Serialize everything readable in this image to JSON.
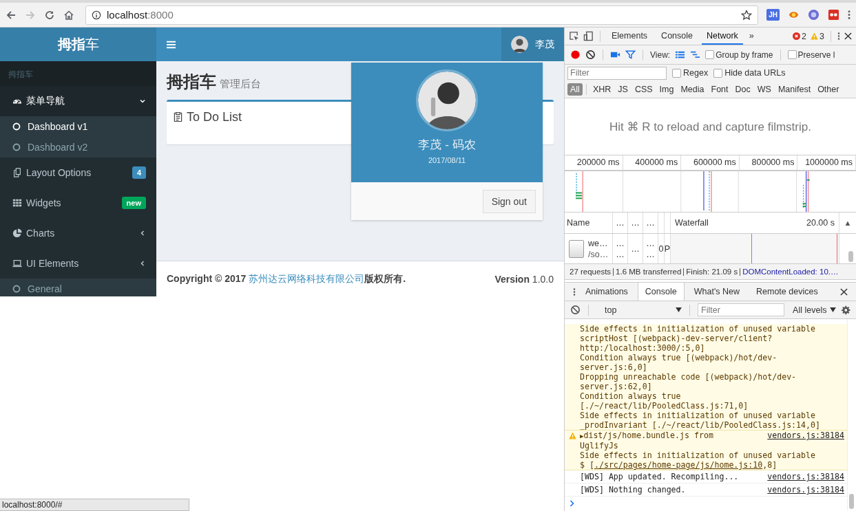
{
  "browser": {
    "url": {
      "host": "localhost",
      "port": ":8000"
    },
    "extension_label": "JH",
    "status_url": "localhost:8000/#"
  },
  "app": {
    "logo": "**拇指**车",
    "user": {
      "name": "李茂"
    },
    "sidebar": {
      "section": "拇指车",
      "items": [
        {
          "label": "菜单导航",
          "kind": "gauge",
          "selected": true,
          "expanded": true,
          "children": [
            {
              "label": "Dashboard v1",
              "selected": true
            },
            {
              "label": "Dashboard v2",
              "selected": false
            }
          ]
        },
        {
          "label": "Layout Options",
          "kind": "copy",
          "selected": false,
          "badge": {
            "text": "4",
            "color": "#3c8dbc"
          }
        },
        {
          "label": "Widgets",
          "kind": "grid",
          "selected": false,
          "badge": {
            "text": "new",
            "color": "#00a65a"
          }
        },
        {
          "label": "Charts",
          "kind": "pie",
          "selected": false,
          "expanded": false
        },
        {
          "label": "UI Elements",
          "kind": "laptop",
          "selected": false,
          "expanded": false,
          "children": [
            {
              "label": "General",
              "selected": false
            }
          ]
        }
      ]
    },
    "page_title": "拇指车",
    "page_subtitle": "管理后台",
    "box": {
      "title": "To Do List"
    },
    "user_menu": {
      "name": "李茂 - 码农",
      "date": "2017/08/11",
      "button": "Sign out"
    },
    "footer": {
      "copyright_before": "Copyright © 2017 ",
      "company": "苏州达云网络科技有限公司",
      "copyright_after": "版权所有.",
      "version": "**Version** 1.0.0"
    }
  },
  "devtools": {
    "tabs": [
      {
        "label": "Elements",
        "selected": false
      },
      {
        "label": "Console",
        "selected": false
      },
      {
        "label": "Network",
        "selected": true
      }
    ],
    "more_tabs": "»",
    "errors": "2",
    "warnings": "3",
    "network": {
      "view_label": "View:",
      "options": [
        {
          "label": "Group by frame",
          "checked": false
        },
        {
          "label": "Preserve l",
          "checked": false
        }
      ],
      "filter_placeholder": "Filter",
      "filter_options": [
        {
          "label": "Regex",
          "checked": false
        },
        {
          "label": "Hide data URLs",
          "checked": false
        }
      ],
      "types": [
        {
          "label": "All",
          "selected": true
        },
        {
          "label": "XHR",
          "selected": false
        },
        {
          "label": "JS",
          "selected": false
        },
        {
          "label": "CSS",
          "selected": false
        },
        {
          "label": "Img",
          "selected": false
        },
        {
          "label": "Media",
          "selected": false
        },
        {
          "label": "Font",
          "selected": false
        },
        {
          "label": "Doc",
          "selected": false
        },
        {
          "label": "WS",
          "selected": false
        },
        {
          "label": "Manifest",
          "selected": false
        },
        {
          "label": "Other",
          "selected": false
        }
      ],
      "filmstrip_hint": "Hit ⌘ R to reload and capture filmstrip.",
      "ticks": [
        "200000 ms",
        "400000 ms",
        "600000 ms",
        "800000 ms",
        "1000000 ms"
      ],
      "columns": [
        "Name",
        "…",
        "…",
        "…"
      ],
      "waterfall_label": "Waterfall",
      "time_scale": "20.00 s",
      "sort_indicator": "▲",
      "rows": [
        {
          "cells": [
            [
              "we…",
              "/so…"
            ],
            [
              "…",
              "…"
            ],
            [
              "…"
            ],
            [
              "…",
              "…"
            ],
            [
              "0"
            ],
            [
              "P"
            ]
          ]
        }
      ],
      "summary": [
        "27 requests",
        "1.6 MB transferred",
        "Finish: 21.09 s"
      ],
      "dom_loaded": "DOMContentLoaded: 10.…"
    },
    "drawer": {
      "tabs": [
        {
          "label": "Animations",
          "selected": false
        },
        {
          "label": "Console",
          "selected": true
        },
        {
          "label": "What's New",
          "selected": false
        },
        {
          "label": "Remote devices",
          "selected": false
        }
      ],
      "context": "top",
      "filter_placeholder": "Filter",
      "levels": "All levels",
      "messages": [
        {
          "kind": "warning",
          "lines": [
            "Side effects in initialization of unused variable",
            "scriptHost [(webpack)-dev-server/client?",
            "http:/localhost:3000/:5,0]",
            "Condition always true [(webpack)/hot/dev-",
            "server.js:6,0]",
            "Dropping unreachable code [(webpack)/hot/dev-",
            "server.js:62,0]",
            "Condition always true",
            "[./~/react/lib/PooledClass.js:71,0]",
            "Side effects in initialization of unused variable",
            "_prodInvariant [./~/react/lib/PooledClass.js:14,0]"
          ]
        },
        {
          "kind": "warning",
          "toggle": "▶",
          "lines": [
            "dist/js/home.bundle.js from",
            "UglifyJs",
            "Side effects in initialization of unused variable"
          ],
          "link_line": {
            "before": "$ [",
            "link": "./src/pages/home-page/js/home.js:10",
            "after": ",8]"
          },
          "source": "vendors.js:38184"
        },
        {
          "kind": "info",
          "lines": [
            "[WDS] App updated. Recompiling..."
          ],
          "source": "vendors.js:38184"
        },
        {
          "kind": "info",
          "lines": [
            "[WDS] Nothing changed."
          ],
          "source": "vendors.js:38184"
        }
      ]
    }
  }
}
